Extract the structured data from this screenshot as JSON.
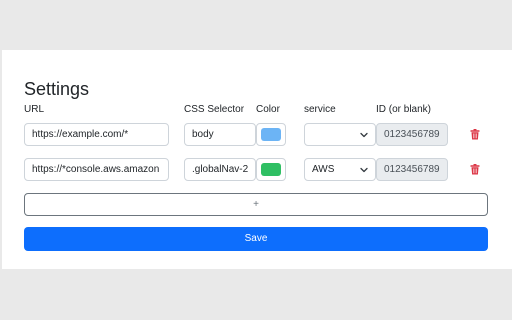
{
  "page": {
    "title": "Settings",
    "columns": {
      "url": "URL",
      "css_selector": "CSS Selector",
      "color": "Color",
      "service": "service",
      "id": "ID (or blank)"
    },
    "rows": [
      {
        "url": "https://example.com/*",
        "selector": "body",
        "color": "#6cb4f5",
        "service": "",
        "id_placeholder": "0123456789"
      },
      {
        "url": "https://*console.aws.amazon",
        "selector": ".globalNav-2",
        "color": "#2fbf63",
        "service": "AWS",
        "id_placeholder": "0123456789"
      }
    ],
    "add_label": "+",
    "save_label": "Save"
  },
  "colors": {
    "primary": "#0d6efd",
    "danger": "#dc3545",
    "background": "#e9e9e9"
  },
  "icons": {
    "delete": "trash-icon",
    "dropdown": "chevron-down-icon"
  }
}
